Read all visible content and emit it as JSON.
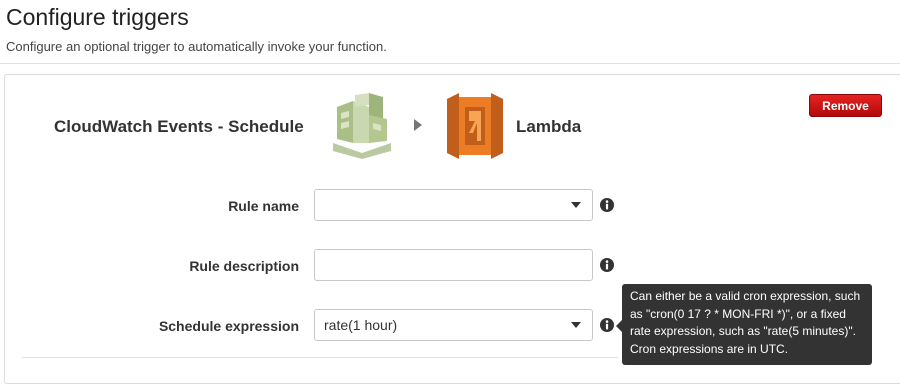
{
  "header": {
    "title": "Configure triggers",
    "subtitle": "Configure an optional trigger to automatically invoke your function."
  },
  "trigger": {
    "source_label": "CloudWatch Events - Schedule",
    "target_label": "Lambda",
    "remove_label": "Remove",
    "source_icon": "cloudwatch-events-icon",
    "target_icon": "lambda-icon",
    "remove_color": "#cc1010"
  },
  "form": {
    "rule_name": {
      "label": "Rule name",
      "value": ""
    },
    "rule_description": {
      "label": "Rule description",
      "value": ""
    },
    "schedule_expression": {
      "label": "Schedule expression",
      "value": "rate(1 hour)"
    }
  },
  "tooltip": {
    "lines": [
      "Can either be a valid cron expression, such",
      "as \"cron(0 17 ? * MON-FRI *)\", or a fixed",
      "rate expression, such as \"rate(5 minutes)\".",
      "Cron expressions are in UTC."
    ]
  }
}
